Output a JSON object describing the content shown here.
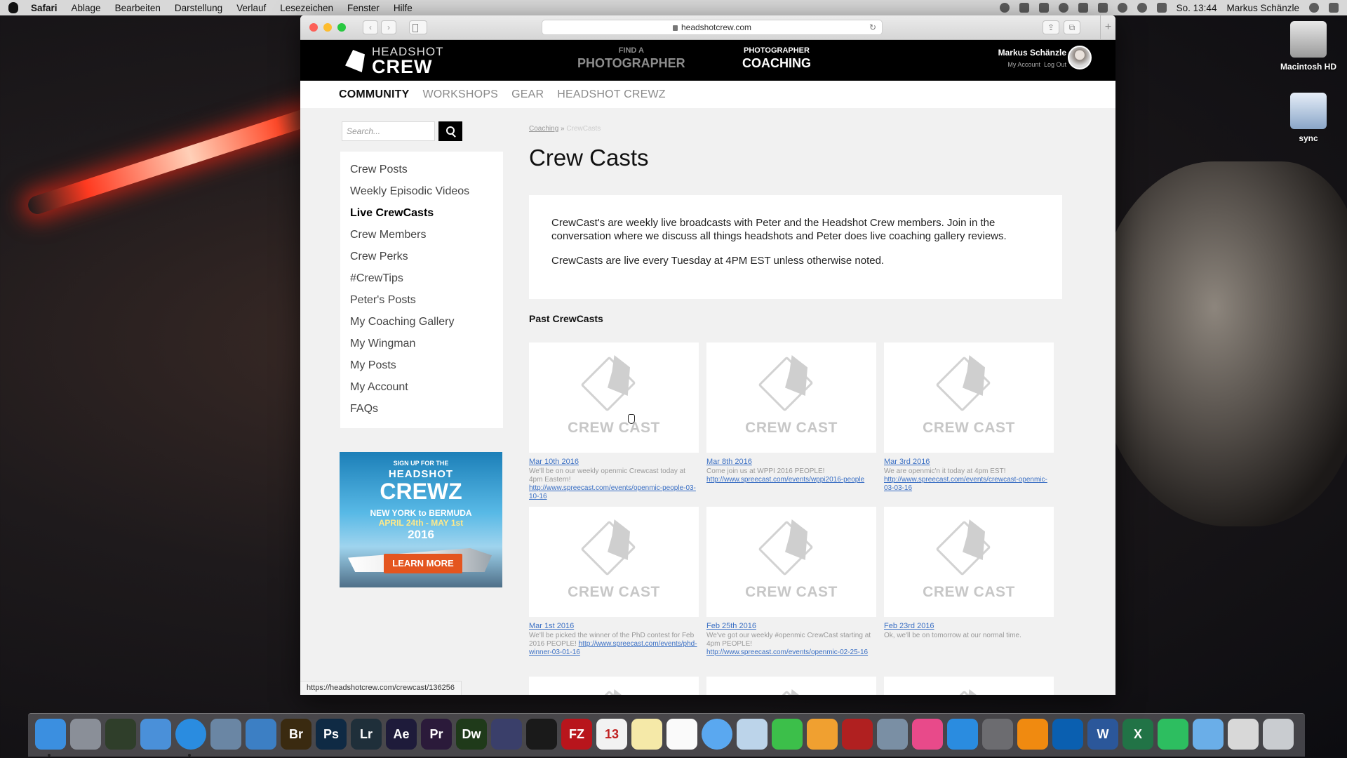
{
  "menubar": {
    "app": "Safari",
    "items": [
      "Ablage",
      "Bearbeiten",
      "Darstellung",
      "Verlauf",
      "Lesezeichen",
      "Fenster",
      "Hilfe"
    ],
    "clock": "So. 13:44",
    "user": "Markus Schänzle"
  },
  "desktop": {
    "icons": [
      "Macintosh HD",
      "sync"
    ]
  },
  "browser": {
    "url": "headshotcrew.com",
    "status_url": "https://headshotcrew.com/crewcast/136256"
  },
  "site": {
    "logo": {
      "line1": "HEADSHOT",
      "line2": "CREW"
    },
    "header_nav": [
      {
        "small": "FIND A",
        "big": "PHOTOGRAPHER"
      },
      {
        "small": "PHOTOGRAPHER",
        "big": "COACHING"
      }
    ],
    "user": {
      "name": "Markus Schänzle",
      "my_account": "My Account",
      "logout": "Log Out"
    },
    "subnav": [
      "COMMUNITY",
      "WORKSHOPS",
      "GEAR",
      "HEADSHOT CREWZ"
    ],
    "subnav_active": "COMMUNITY"
  },
  "sidebar": {
    "search_placeholder": "Search...",
    "items": [
      "Crew Posts",
      "Weekly Episodic Videos",
      "Live CrewCasts",
      "Crew Members",
      "Crew Perks",
      "#CrewTips",
      "Peter's Posts",
      "My Coaching Gallery",
      "My Wingman",
      "My Posts",
      "My Account",
      "FAQs"
    ],
    "active": "Live CrewCasts",
    "ad": {
      "line1": "SIGN UP FOR THE",
      "line2": "HEADSHOT",
      "line3": "CREWZ",
      "line4": "NEW YORK to BERMUDA",
      "line5": "APRIL 24th - MAY 1st",
      "line6": "2016",
      "button": "LEARN MORE"
    }
  },
  "main": {
    "breadcrumb": {
      "parent": "Coaching",
      "sep": "»",
      "current": "CrewCasts"
    },
    "title": "Crew Casts",
    "intro_p1": "CrewCast's are weekly live broadcasts with Peter and the Headshot Crew members. Join in the conversation where we discuss all things headshots and Peter does live coaching gallery reviews.",
    "intro_p2": "CrewCasts are live every Tuesday at 4PM EST unless otherwise noted.",
    "past_heading": "Past CrewCasts",
    "thumb_label": "CREW CAST",
    "casts": [
      {
        "date": "Mar 10th 2016",
        "desc": "We'll be on our weekly openmic Crewcast today at 4pm Eastern!",
        "link": "http://www.spreecast.com/events/openmic-people-03-10-16"
      },
      {
        "date": "Mar 8th 2016",
        "desc": "Come join us at WPPI 2016 PEOPLE!",
        "link": "http://www.spreecast.com/events/wppi2016-people"
      },
      {
        "date": "Mar 3rd 2016",
        "desc": "We are openmic'n it today at 4pm EST!",
        "link": "http://www.spreecast.com/events/crewcast-openmic-03-03-16"
      },
      {
        "date": "Mar 1st 2016",
        "desc": "We'll be picked the winner of the PhD contest for Feb 2016 PEOPLE!",
        "link": "http://www.spreecast.com/events/phd-winner-03-01-16"
      },
      {
        "date": "Feb 25th 2016",
        "desc": "We've got our weekly #openmic CrewCast starting at 4pm PEOPLE!",
        "link": "http://www.spreecast.com/events/openmic-02-25-16"
      },
      {
        "date": "Feb 23rd 2016",
        "desc": "Ok, we'll be on tomorrow at our normal time.",
        "link": ""
      }
    ]
  },
  "dock": {
    "apps": [
      {
        "label": "",
        "icon": "finder-icon",
        "color": "#3b8fe0"
      },
      {
        "label": "",
        "icon": "launchpad-icon",
        "color": "#8a8f98"
      },
      {
        "label": "",
        "icon": "mission-control-icon",
        "color": "#2f3e2a"
      },
      {
        "label": "",
        "icon": "photo-browser-icon",
        "color": "#4a90d9"
      },
      {
        "label": "",
        "icon": "safari-icon",
        "color": "#2a8ce0"
      },
      {
        "label": "",
        "icon": "preview-icon",
        "color": "#6a86a4"
      },
      {
        "label": "",
        "icon": "1password-icon",
        "color": "#3c7fc4"
      },
      {
        "label": "Br",
        "icon": "bridge-icon",
        "color": "#3a2a10"
      },
      {
        "label": "Ps",
        "icon": "photoshop-icon",
        "color": "#0f2a44"
      },
      {
        "label": "Lr",
        "icon": "lightroom-icon",
        "color": "#1f2f3a"
      },
      {
        "label": "Ae",
        "icon": "after-effects-icon",
        "color": "#1e1b3a"
      },
      {
        "label": "Pr",
        "icon": "premiere-icon",
        "color": "#2b1a3a"
      },
      {
        "label": "Dw",
        "icon": "dreamweaver-icon",
        "color": "#1f3a1a"
      },
      {
        "label": "",
        "icon": "imovie-icon",
        "color": "#3a3f6a"
      },
      {
        "label": "",
        "icon": "terminal-icon",
        "color": "#1a1a1a"
      },
      {
        "label": "FZ",
        "icon": "filezilla-icon",
        "color": "#b8151c"
      },
      {
        "label": "13",
        "icon": "calendar-icon",
        "color": "#f2f2f2"
      },
      {
        "label": "",
        "icon": "notes-icon",
        "color": "#f5e9a8"
      },
      {
        "label": "",
        "icon": "reminders-icon",
        "color": "#fafafa"
      },
      {
        "label": "",
        "icon": "messages-icon",
        "color": "#5aa8f0"
      },
      {
        "label": "",
        "icon": "mail-icon",
        "color": "#bcd4ea"
      },
      {
        "label": "",
        "icon": "facetime-icon",
        "color": "#3cbf4a"
      },
      {
        "label": "",
        "icon": "photos-icon",
        "color": "#f0a030"
      },
      {
        "label": "",
        "icon": "photo-booth-icon",
        "color": "#b02020"
      },
      {
        "label": "",
        "icon": "scanner-icon",
        "color": "#7a8fa4"
      },
      {
        "label": "",
        "icon": "itunes-icon",
        "color": "#e84a8a"
      },
      {
        "label": "",
        "icon": "app-store-icon",
        "color": "#2a8ce0"
      },
      {
        "label": "",
        "icon": "system-preferences-icon",
        "color": "#6c6c70"
      },
      {
        "label": "",
        "icon": "vlc-icon",
        "color": "#f08a10"
      },
      {
        "label": "",
        "icon": "teamviewer-icon",
        "color": "#0a5fb0"
      },
      {
        "label": "W",
        "icon": "word-icon",
        "color": "#2b579a"
      },
      {
        "label": "X",
        "icon": "excel-icon",
        "color": "#217346"
      },
      {
        "label": "",
        "icon": "evernote-icon",
        "color": "#2dbe60"
      },
      {
        "label": "",
        "icon": "folder-icon",
        "color": "#6aaee8"
      },
      {
        "label": "",
        "icon": "brushes-icon",
        "color": "#d8d8d8"
      },
      {
        "label": "",
        "icon": "trash-icon",
        "color": "#c9ccd0"
      }
    ]
  }
}
